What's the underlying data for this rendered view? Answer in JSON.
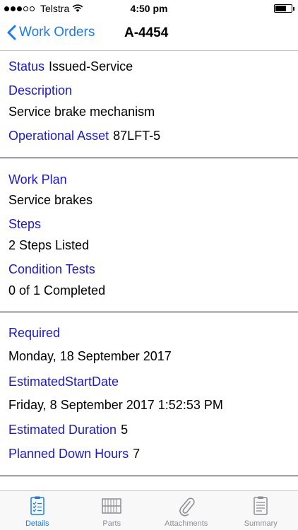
{
  "status_bar": {
    "carrier": "Telstra",
    "time": "4:50 pm",
    "signal_bars": 3
  },
  "nav": {
    "back_label": "Work Orders",
    "title": "A-4454"
  },
  "details": {
    "status_label": "Status",
    "status_value": "Issued-Service",
    "description_label": "Description",
    "description_value": "Service brake mechanism",
    "asset_label": "Operational Asset",
    "asset_value": "87LFT-5"
  },
  "plan": {
    "work_plan_label": "Work Plan",
    "work_plan_value": "Service brakes",
    "steps_label": "Steps",
    "steps_value": "2 Steps Listed",
    "condition_label": "Condition Tests",
    "condition_value": "0 of 1 Completed"
  },
  "schedule": {
    "required_label": "Required",
    "required_value": "Monday, 18 September 2017",
    "est_start_label": "EstimatedStartDate",
    "est_start_value": "Friday, 8 September 2017 1:52:53 PM",
    "est_duration_label": "Estimated Duration",
    "est_duration_value": "5",
    "down_hours_label": "Planned Down Hours",
    "down_hours_value": "7"
  },
  "tabs": [
    {
      "label": "Details",
      "icon": "checklist-icon",
      "active": true
    },
    {
      "label": "Parts",
      "icon": "parts-icon",
      "active": false
    },
    {
      "label": "Attachments",
      "icon": "paperclip-icon",
      "active": false
    },
    {
      "label": "Summary",
      "icon": "summary-icon",
      "active": false
    }
  ],
  "colors": {
    "accent": "#1a7cf5",
    "label": "#1a1acc",
    "inactive": "#8e8e93"
  }
}
